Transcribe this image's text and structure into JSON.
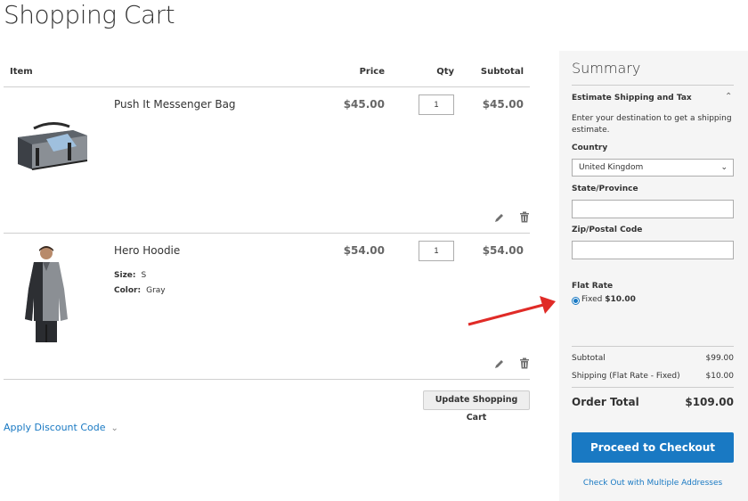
{
  "page": {
    "title": "Shopping Cart"
  },
  "cart": {
    "headers": {
      "item": "Item",
      "price": "Price",
      "qty": "Qty",
      "subtotal": "Subtotal"
    },
    "items": [
      {
        "name": "Push It Messenger Bag",
        "price": "$45.00",
        "qty": "1",
        "subtotal": "$45.00",
        "options": []
      },
      {
        "name": "Hero Hoodie",
        "price": "$54.00",
        "qty": "1",
        "subtotal": "$54.00",
        "options": [
          {
            "label": "Size:",
            "value": "S"
          },
          {
            "label": "Color:",
            "value": "Gray"
          }
        ]
      }
    ],
    "update_button": "Update Shopping Cart",
    "discount_link": "Apply Discount Code"
  },
  "summary": {
    "title": "Summary",
    "estimate": {
      "title": "Estimate Shipping and Tax",
      "description": "Enter your destination to get a shipping estimate.",
      "country_label": "Country",
      "country_value": "United Kingdom",
      "state_label": "State/Province",
      "state_value": "",
      "zip_label": "Zip/Postal Code",
      "zip_value": ""
    },
    "shipping": {
      "method_title": "Flat Rate",
      "option_label": "Fixed",
      "option_price": "$10.00",
      "selected": true
    },
    "totals": {
      "subtotal_label": "Subtotal",
      "subtotal_value": "$99.00",
      "shipping_label": "Shipping (Flat Rate - Fixed)",
      "shipping_value": "$10.00",
      "order_total_label": "Order Total",
      "order_total_value": "$109.00"
    },
    "checkout_button": "Proceed to Checkout",
    "multi_address_link": "Check Out with Multiple Addresses"
  },
  "colors": {
    "accent": "#1979c3",
    "annotation_arrow": "#e02b27",
    "summary_bg": "#f5f5f5"
  },
  "icons": [
    "edit-pencil-icon",
    "trash-icon",
    "chevron-down-icon",
    "chevron-up-icon"
  ]
}
